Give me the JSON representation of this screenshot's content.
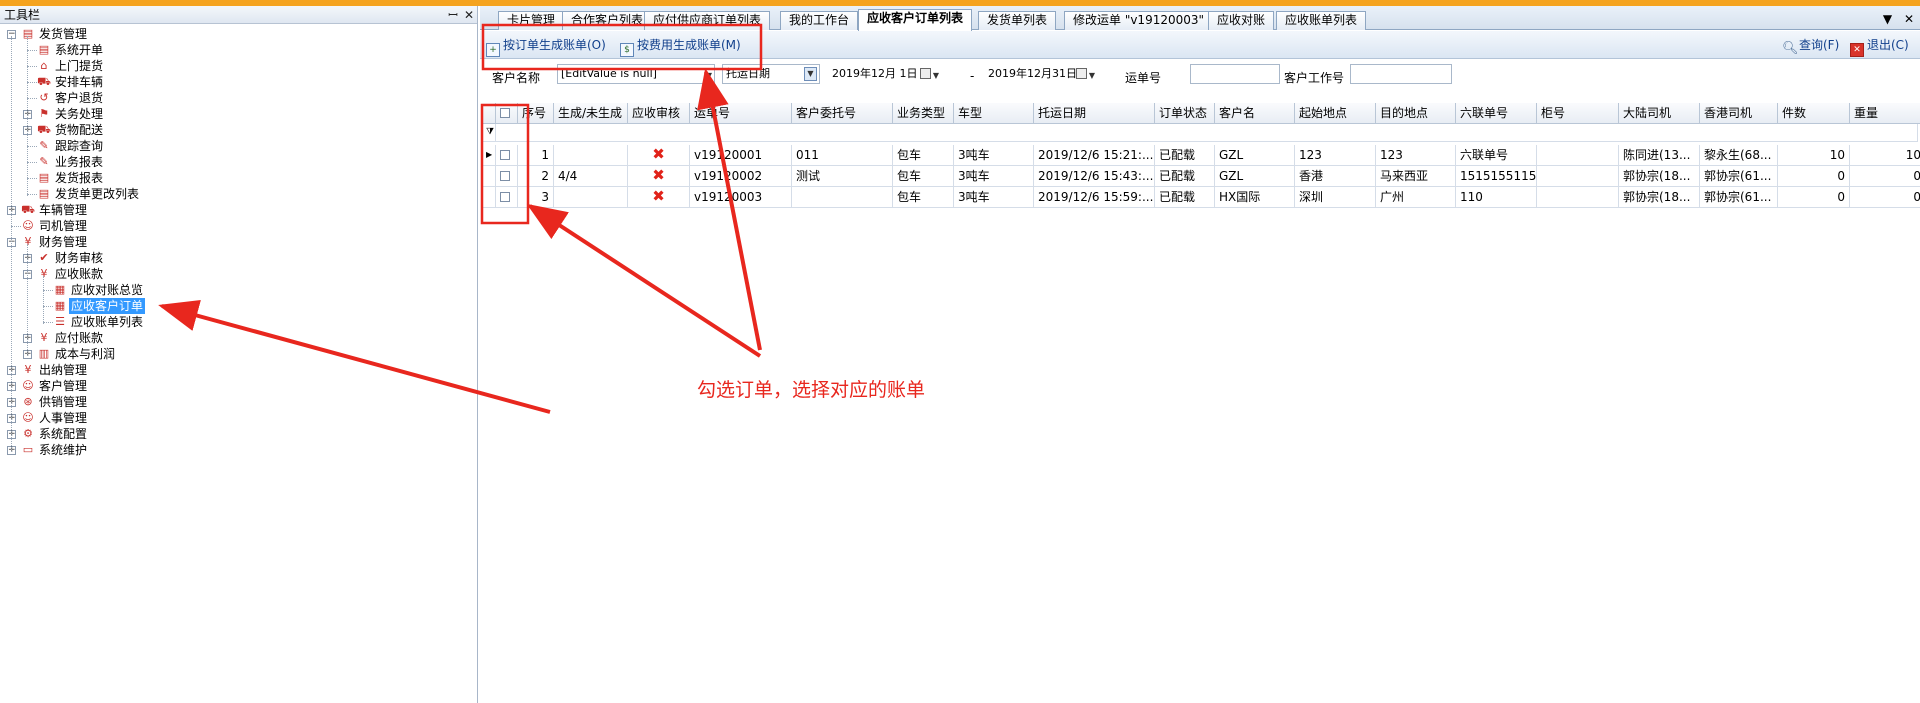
{
  "left_panel": {
    "title": "工具栏",
    "pin_icon": "pin-icon",
    "close_icon": "close-icon",
    "tree": [
      {
        "label": "发货管理",
        "level": 0,
        "expander": "−",
        "icon": "document-icon"
      },
      {
        "label": "系统开单",
        "level": 1,
        "expander": "",
        "icon": "document-icon"
      },
      {
        "label": "上门提货",
        "level": 1,
        "expander": "",
        "icon": "pickup-icon"
      },
      {
        "label": "安排车辆",
        "level": 1,
        "expander": "",
        "icon": "truck-icon"
      },
      {
        "label": "客户退货",
        "level": 1,
        "expander": "",
        "icon": "return-icon"
      },
      {
        "label": "关务处理",
        "level": 1,
        "expander": "+",
        "icon": "customs-icon"
      },
      {
        "label": "货物配送",
        "level": 1,
        "expander": "+",
        "icon": "delivery-icon"
      },
      {
        "label": "跟踪查询",
        "level": 1,
        "expander": "",
        "icon": "pencil-icon"
      },
      {
        "label": "业务报表",
        "level": 1,
        "expander": "",
        "icon": "pencil-icon"
      },
      {
        "label": "发货报表",
        "level": 1,
        "expander": "",
        "icon": "document-icon"
      },
      {
        "label": "发货单更改列表",
        "level": 1,
        "expander": "",
        "icon": "document-icon"
      },
      {
        "label": "车辆管理",
        "level": 0,
        "expander": "+",
        "icon": "truck-icon"
      },
      {
        "label": "司机管理",
        "level": 0,
        "expander": "",
        "icon": "person-icon"
      },
      {
        "label": "财务管理",
        "level": 0,
        "expander": "−",
        "icon": "finance-icon"
      },
      {
        "label": "财务审核",
        "level": 1,
        "expander": "+",
        "icon": "audit-icon"
      },
      {
        "label": "应收账款",
        "level": 1,
        "expander": "−",
        "icon": "yen-icon"
      },
      {
        "label": "应收对账总览",
        "level": 2,
        "expander": "",
        "icon": "ledger-icon"
      },
      {
        "label": "应收客户订单",
        "level": 2,
        "expander": "",
        "icon": "ledger-icon",
        "selected": true
      },
      {
        "label": "应收账单列表",
        "level": 2,
        "expander": "",
        "icon": "list-icon"
      },
      {
        "label": "应付账款",
        "level": 1,
        "expander": "+",
        "icon": "yen-icon"
      },
      {
        "label": "成本与利润",
        "level": 1,
        "expander": "+",
        "icon": "chart-icon"
      },
      {
        "label": "出纳管理",
        "level": 0,
        "expander": "+",
        "icon": "yen-icon"
      },
      {
        "label": "客户管理",
        "level": 0,
        "expander": "+",
        "icon": "person-icon"
      },
      {
        "label": "供销管理",
        "level": 0,
        "expander": "+",
        "icon": "supply-icon"
      },
      {
        "label": "人事管理",
        "level": 0,
        "expander": "+",
        "icon": "people-icon"
      },
      {
        "label": "系统配置",
        "level": 0,
        "expander": "+",
        "icon": "config-icon"
      },
      {
        "label": "系统维护",
        "level": 0,
        "expander": "+",
        "icon": "monitor-icon"
      }
    ]
  },
  "tabs": [
    {
      "label": "卡片管理"
    },
    {
      "label": "合作客户列表"
    },
    {
      "label": "应付供应商订单列表"
    },
    {
      "label": "我的工作台"
    },
    {
      "label": "应收客户订单列表",
      "active": true
    },
    {
      "label": "发货单列表"
    },
    {
      "label": "修改运单 \"v19120003\""
    },
    {
      "label": "应收对账"
    },
    {
      "label": "应收账单列表"
    }
  ],
  "tab_controls": {
    "dropdown": "▼",
    "close": "✕"
  },
  "toolbar": {
    "by_order": "按订单生成账单(O)",
    "by_fee": "按费用生成账单(M)",
    "query": "查询(F)",
    "exit": "退出(C)"
  },
  "filter": {
    "customer_label": "客户名称",
    "customer_value": "[EditValue is null]",
    "date_type": "托运日期",
    "date_from": "2019年12月 1日",
    "date_sep": "-",
    "date_to": "2019年12月31日",
    "waybill_label": "运单号",
    "waybill_value": "",
    "job_label": "客户工作号",
    "job_value": ""
  },
  "grid": {
    "columns": [
      "",
      "序号",
      "生成/未生成",
      "应收审核",
      "运单号",
      "客户委托号",
      "业务类型",
      "车型",
      "托运日期",
      "订单状态",
      "客户名",
      "起始地点",
      "目的地点",
      "六联单号",
      "柜号",
      "大陆司机",
      "香港司机",
      "件数",
      "重量"
    ],
    "rows": [
      {
        "seq": "1",
        "generated": "",
        "audit": "✖",
        "waybill": "v19120001",
        "client_no": "011",
        "biz": "包车",
        "vehicle": "3吨车",
        "date": "2019/12/6 15:21:...",
        "status": "已配载",
        "customer": "GZL",
        "origin": "123",
        "dest": "123",
        "six_no": "六联单号",
        "cabinet": "",
        "mainland_driver": "陈同进(13...",
        "hk_driver": "黎永生(68...",
        "pieces": "10",
        "weight": "10"
      },
      {
        "seq": "2",
        "generated": "4/4",
        "audit": "✖",
        "waybill": "v19120002",
        "client_no": "测试",
        "biz": "包车",
        "vehicle": "3吨车",
        "date": "2019/12/6 15:43:...",
        "status": "已配载",
        "customer": "GZL",
        "origin": "香港",
        "dest": "马来西亚",
        "six_no": "1515155115",
        "cabinet": "",
        "mainland_driver": "郭协宗(18...",
        "hk_driver": "郭协宗(61...",
        "pieces": "0",
        "weight": "0"
      },
      {
        "seq": "3",
        "generated": "",
        "audit": "✖",
        "waybill": "v19120003",
        "client_no": "",
        "biz": "包车",
        "vehicle": "3吨车",
        "date": "2019/12/6 15:59:...",
        "status": "已配载",
        "customer": "HX国际",
        "origin": "深圳",
        "dest": "广州",
        "six_no": "110",
        "cabinet": "",
        "mainland_driver": "郭协宗(18...",
        "hk_driver": "郭协宗(61...",
        "pieces": "0",
        "weight": "0"
      }
    ]
  },
  "annotation": {
    "text": "勾选订单，选择对应的账单",
    "color": "#e8271e"
  },
  "colors": {
    "accent_bar": "#f5a31f",
    "selection": "#3399ff",
    "toolbar_text": "#12408c"
  }
}
